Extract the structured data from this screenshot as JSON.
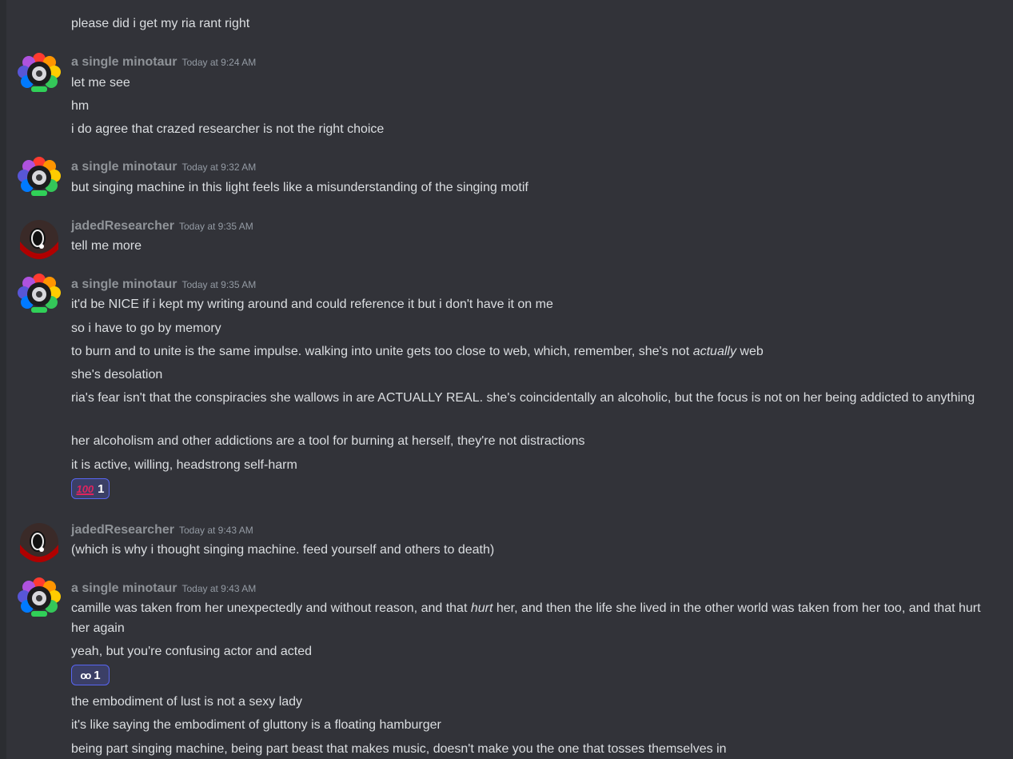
{
  "messages": {
    "first_line": "please did i get my ria rant right",
    "g1": {
      "author": "a single minotaur",
      "time": "Today at 9:24 AM",
      "lines": [
        "let me see",
        "hm",
        "i do agree that crazed researcher is not the right choice"
      ]
    },
    "g2": {
      "author": "a single minotaur",
      "time": "Today at 9:32 AM",
      "lines": [
        "but singing machine in this light feels like a misunderstanding of the singing motif"
      ]
    },
    "g3": {
      "author": "jadedResearcher",
      "time": "Today at 9:35 AM",
      "lines": [
        "tell me more"
      ]
    },
    "g4": {
      "author": "a single minotaur",
      "time": "Today at 9:35 AM",
      "lines": [
        "it'd be NICE if i kept my writing around and could reference it but i don't have it on me",
        "so i have to go by memory",
        "to burn and to unite is the same impulse. walking into unite gets too close to web, which, remember, she's not ",
        "actually",
        " web",
        "she's desolation",
        "ria's fear isn't that the conspiracies she wallows in are ACTUALLY REAL. she's coincidentally an alcoholic, but the focus is not on her being addicted to anything",
        "her alcoholism and other addictions are a tool for burning at herself, they're not distractions",
        "it is active, willing, headstrong self-harm"
      ],
      "reaction": {
        "emoji": "100",
        "count": "1"
      }
    },
    "g5": {
      "author": "jadedResearcher",
      "time": "Today at 9:43 AM",
      "lines": [
        "(which is why i thought singing machine. feed yourself and others to death)"
      ]
    },
    "g6": {
      "author": "a single minotaur",
      "time": "Today at 9:43 AM",
      "lines": [
        "camille was taken from her unexpectedly and without reason, and that ",
        "hurt",
        " her, and then the life she lived in the other world was taken from her too, and that hurt her again",
        "yeah, but you're confusing actor and acted",
        "the embodiment of lust is not a sexy lady",
        "it's like saying the embodiment of gluttony is a floating hamburger",
        "being part singing machine, being part beast that makes music, doesn't make you the one that tosses themselves in"
      ],
      "reaction": {
        "emoji": "oo",
        "count": "1"
      }
    }
  },
  "colors": {
    "background": "#323339",
    "username": "#8f9398",
    "reaction_border": "#5865f2"
  }
}
